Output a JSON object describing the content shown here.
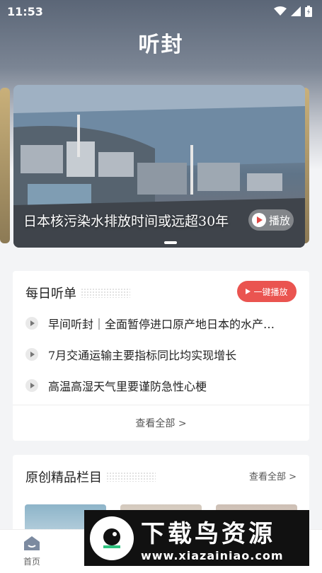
{
  "status_bar": {
    "time": "11:53"
  },
  "header": {
    "title": "听封"
  },
  "banner": {
    "caption": "日本核污染水排放时间或远超30年",
    "play_label": "播放"
  },
  "daily": {
    "title": "每日听单",
    "play_all_label": "一键播放",
    "items": [
      {
        "text": "早间听封｜全面暂停进口原产地日本的水产…"
      },
      {
        "text": "7月交通运输主要指标同比均实现增长"
      },
      {
        "text": "高温高湿天气里要谨防急性心梗"
      }
    ],
    "see_all": "查看全部 >"
  },
  "original": {
    "title": "原创精品栏目",
    "see_all": "查看全部 >"
  },
  "tabbar": {
    "home_label": "首页"
  },
  "watermark": {
    "title": "下载鸟资源",
    "url": "www.xiazainiao.com"
  },
  "colors": {
    "accent": "#ea5450",
    "header_bg": "#5b6677"
  }
}
